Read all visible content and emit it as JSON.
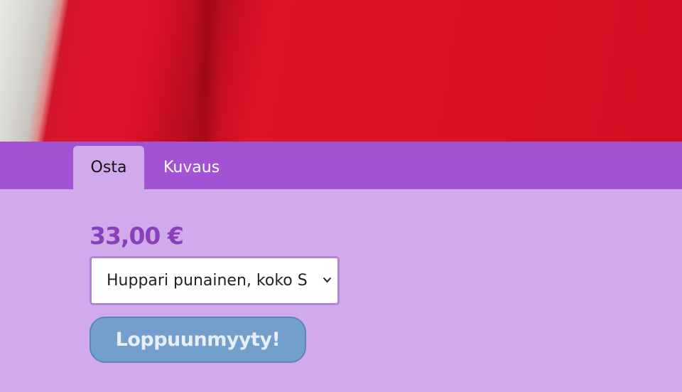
{
  "tabs": [
    {
      "label": "Osta",
      "active": true
    },
    {
      "label": "Kuvaus",
      "active": false
    }
  ],
  "product": {
    "price": "33,00 €",
    "selected_variant": "Huppari punainen, koko S",
    "button_label": "Loppuunmyyty!"
  },
  "colors": {
    "tab_bar": "#a253d4",
    "panel_background": "#d1aaeb",
    "price_color": "#8a3fbd",
    "button_background": "#729fcb"
  }
}
